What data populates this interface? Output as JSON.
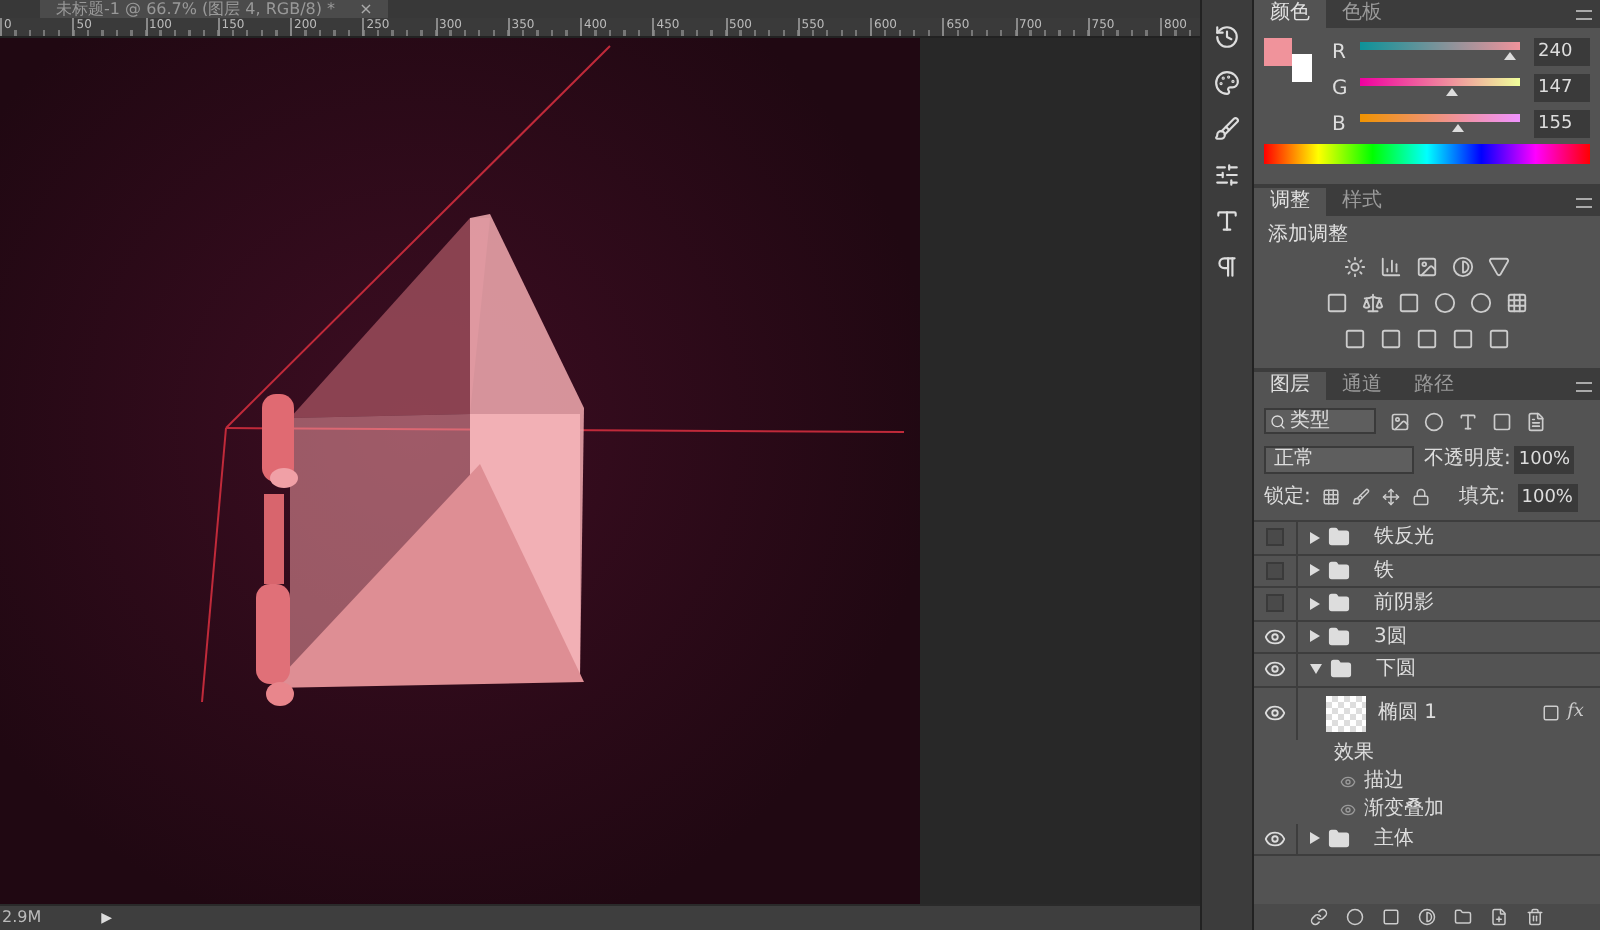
{
  "document_tab": {
    "title": "未标题-1 @ 66.7% (图层 4, RGB/8) *",
    "close": "×"
  },
  "ruler": {
    "ticks": [
      "0",
      "50",
      "100",
      "150",
      "200",
      "250",
      "300",
      "350",
      "400",
      "450",
      "500",
      "550",
      "600",
      "650",
      "700",
      "750",
      "800"
    ]
  },
  "status_bar": {
    "doc_size": "2.9M",
    "arrow": "▶"
  },
  "color_panel": {
    "tabs": [
      {
        "label": "颜色",
        "selected": true
      },
      {
        "label": "色板",
        "selected": false
      }
    ],
    "color": "#f0939b",
    "channels": [
      {
        "name": "R",
        "value": "240",
        "level": 0.94
      },
      {
        "name": "G",
        "value": "147",
        "level": 0.58
      },
      {
        "name": "B",
        "value": "155",
        "level": 0.61
      }
    ]
  },
  "adjustments_panel": {
    "tabs": [
      {
        "label": "调整",
        "selected": true
      },
      {
        "label": "样式",
        "selected": false
      }
    ],
    "heading": "添加调整"
  },
  "layers_panel": {
    "tabs": [
      {
        "label": "图层",
        "selected": true
      },
      {
        "label": "通道",
        "selected": false
      },
      {
        "label": "路径",
        "selected": false
      }
    ],
    "filter": "类型",
    "blend_mode": "正常",
    "opacity_label": "不透明度:",
    "opacity": "100%",
    "lock_label": "锁定:",
    "fill_label": "填充:",
    "fill": "100%",
    "layers": [
      {
        "name": "铁反光",
        "kind": "group",
        "visible": false,
        "expanded": false
      },
      {
        "name": "铁",
        "kind": "group",
        "visible": false,
        "expanded": false
      },
      {
        "name": "前阴影",
        "kind": "group",
        "visible": false,
        "expanded": false
      },
      {
        "name": "3圆",
        "kind": "group",
        "visible": true,
        "expanded": false
      },
      {
        "name": "下圆",
        "kind": "group",
        "visible": true,
        "expanded": true,
        "children": [
          {
            "name": "椭圆 1",
            "kind": "layer",
            "visible": true,
            "fx_label": "fx",
            "effects_label": "效果",
            "effects": [
              "描边",
              "渐变叠加"
            ]
          }
        ]
      },
      {
        "name": "主体",
        "kind": "group",
        "visible": true,
        "expanded": false
      }
    ]
  }
}
